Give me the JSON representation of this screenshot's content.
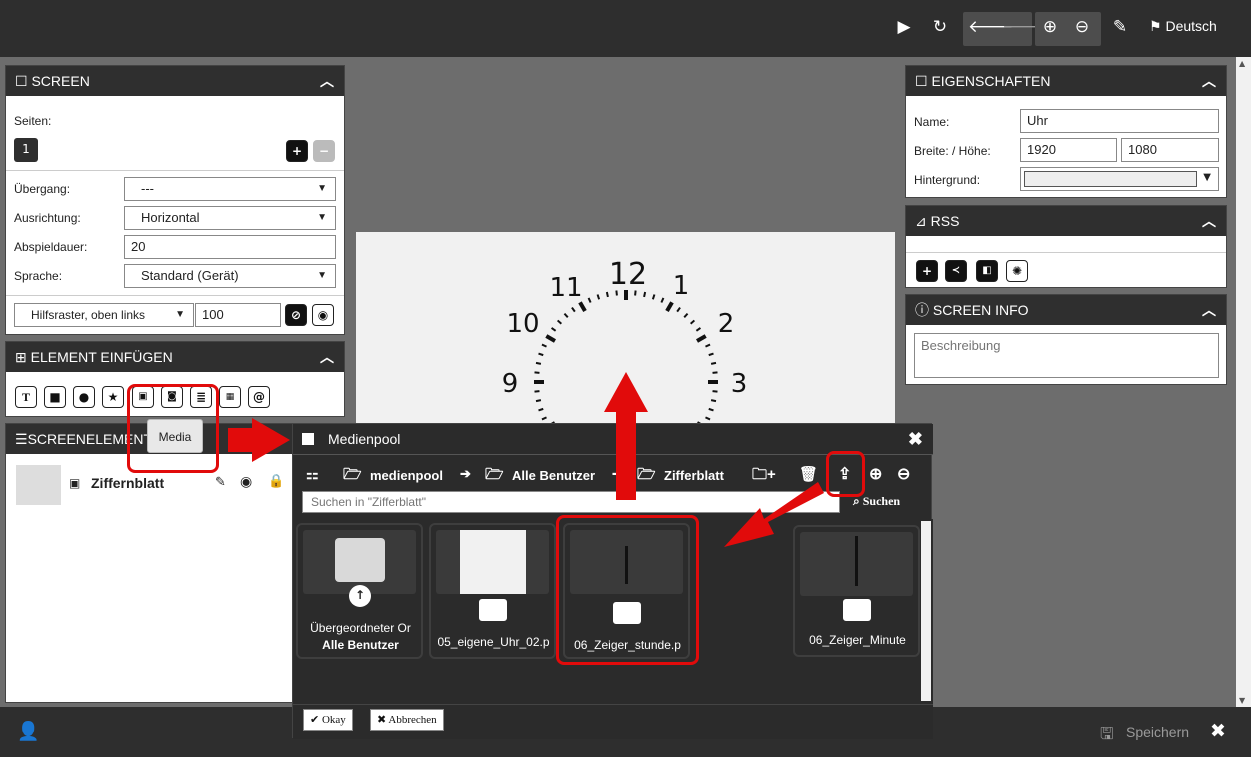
{
  "topbar": {
    "language": "Deutsch"
  },
  "screen_panel": {
    "title": "SCREEN",
    "pages_label": "Seiten:",
    "page_number": "1",
    "transition_label": "Übergang:",
    "transition_value": "---",
    "orientation_label": "Ausrichtung:",
    "orientation_value": "Horizontal",
    "duration_label": "Abspieldauer:",
    "duration_value": "20",
    "language_label": "Sprache:",
    "language_value": "Standard (Gerät)",
    "grid_value": "Hilfsraster, oben links",
    "grid_size": "100"
  },
  "insert_panel": {
    "title": "ELEMENT EINFÜGEN",
    "tooltip": "Media"
  },
  "elements_panel": {
    "title": "SCREENELEMENTE",
    "item_label": "Ziffernblatt"
  },
  "properties_panel": {
    "title": "EIGENSCHAFTEN",
    "name_label": "Name:",
    "name_value": "Uhr",
    "size_label": "Breite: / Höhe:",
    "width_value": "1920",
    "height_value": "1080",
    "background_label": "Hintergrund:"
  },
  "rss_panel": {
    "title": "RSS"
  },
  "info_panel": {
    "title": "SCREEN INFO",
    "description_placeholder": "Beschreibung"
  },
  "clock": {
    "numbers": [
      "12",
      "1",
      "2",
      "3",
      "9",
      "10",
      "11"
    ]
  },
  "media_dialog": {
    "title": "Medienpool",
    "breadcrumb": [
      "medienpool",
      "Alle Benutzer",
      "Zifferblatt"
    ],
    "search_placeholder": "Suchen in \"Zifferblatt\"",
    "search_button": "Suchen",
    "items": [
      {
        "name": "Übergeordneter Or",
        "sub": "Alle Benutzer"
      },
      {
        "name": "05_eigene_Uhr_02.p"
      },
      {
        "name": "06_Zeiger_stunde.p"
      },
      {
        "name": "06_Zeiger_Minute"
      }
    ],
    "ok_label": "Okay",
    "cancel_label": "Abbrechen"
  },
  "bottombar": {
    "save_label": "Speichern"
  }
}
